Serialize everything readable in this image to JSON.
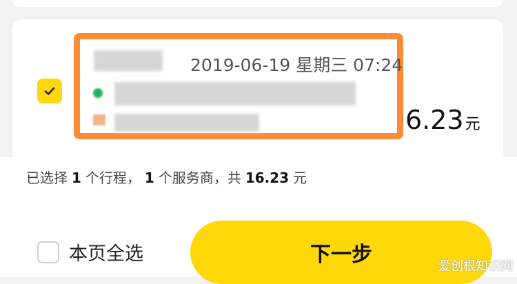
{
  "trip": {
    "time": "2019-06-19 星期三 07:24",
    "amount": "6.23",
    "amount_unit": "元",
    "selected": true
  },
  "summary": {
    "prefix": "已选择",
    "trip_count": "1",
    "trip_unit": "个行程，",
    "provider_count": "1",
    "provider_unit": "个服务商，共",
    "total": "16.23",
    "total_unit": "元"
  },
  "footer": {
    "select_all_label": "本页全选",
    "next_button_label": "下一步"
  },
  "watermark": "爱创根知识网",
  "colors": {
    "accent": "#ffd80a",
    "highlight": "#ff8c34"
  }
}
